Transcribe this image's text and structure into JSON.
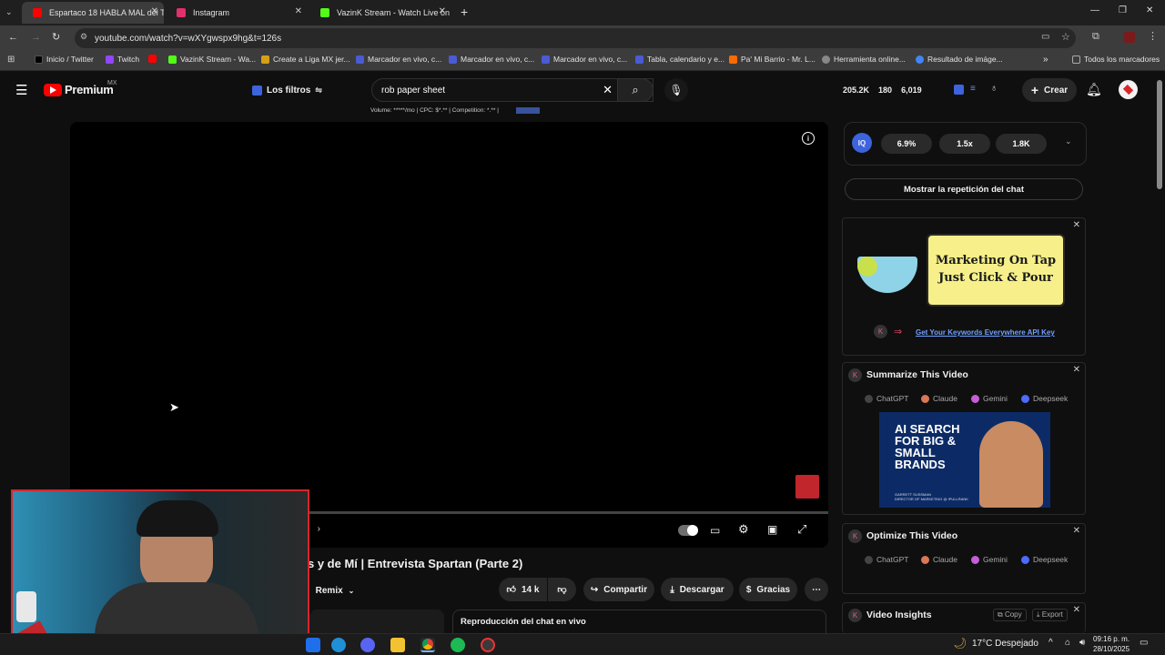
{
  "browser": {
    "tabs": [
      {
        "label": "Espartaco 18 HABLA MAL del T",
        "color": "#ff0000"
      },
      {
        "label": "Instagram",
        "color": "#e1306c"
      },
      {
        "label": "VazinK Stream - Watch Live on",
        "color": "#53fc18"
      }
    ],
    "new_tab": "+",
    "url": "youtube.com/watch?v=wXYgwspx9hg&t=126s",
    "bookmarks": [
      {
        "label": "Inicio / Twitter",
        "color": "#000000"
      },
      {
        "label": "Twitch",
        "color": "#9146ff"
      },
      {
        "label": "",
        "color": "#ff0000"
      },
      {
        "label": "VazinK Stream - Wa...",
        "color": "#53fc18"
      },
      {
        "label": "Create a Liga MX jer...",
        "color": "#d4a017"
      },
      {
        "label": "Marcador en vivo, c...",
        "color": "#4a5bd4"
      },
      {
        "label": "Marcador en vivo, c...",
        "color": "#4a5bd4"
      },
      {
        "label": "Marcador en vivo, c...",
        "color": "#4a5bd4"
      },
      {
        "label": "Tabla, calendario y e...",
        "color": "#4a5bd4"
      },
      {
        "label": "Pa' Mi Barrio - Mr. L...",
        "color": "#ff6a00"
      },
      {
        "label": "Herramienta online...",
        "color": "#888888"
      },
      {
        "label": "Resultado de imáge...",
        "color": "#4285f4"
      }
    ],
    "bookmarks_more": "»",
    "all_bookmarks": "Todos los marcadores"
  },
  "youtube": {
    "logo": "Premium",
    "region": "MX",
    "filters_label": "Los filtros",
    "search_value": "rob paper sheet",
    "keyword_stats": "Volume: *****/mo | CPC: $*.** | Competition: *.** |",
    "header_stats": {
      "a": "205.2K",
      "b": "180",
      "c": "6,019"
    },
    "create_label": "Crear",
    "video_title": "s y de Mí | Entrevista Spartan (Parte 2)",
    "remix_label": "Remix",
    "likes": "14 k",
    "share_label": "Compartir",
    "download_label": "Descargar",
    "thanks_label": "Gracias",
    "chat_replay_bottom": "Reproducción del chat en vivo",
    "ctrl_more": "o"
  },
  "sidebar": {
    "metrics": [
      "6.9%",
      "1.5x",
      "1.8K"
    ],
    "show_chat_replay": "Mostrar la repetición del chat",
    "ad": {
      "headline1": "Marketing On Tap",
      "headline2": "Just Click & Pour",
      "link": "Get Your Keywords Everywhere API Key"
    },
    "summarize": {
      "title": "Summarize This Video",
      "tools": [
        "ChatGPT",
        "Claude",
        "Gemini",
        "Deepseek"
      ],
      "banner_line1": "AI SEARCH",
      "banner_line2": "FOR BIG &",
      "banner_line3": "SMALL",
      "banner_line4": "BRANDS",
      "banner_caption1": "GARRETT SUSSMAN",
      "banner_caption2": "DIRECTOR OF MARKETING @ IPULLRANK"
    },
    "optimize": {
      "title": "Optimize This Video",
      "tools": [
        "ChatGPT",
        "Claude",
        "Gemini",
        "Deepseek"
      ]
    },
    "insights": {
      "title": "Video Insights",
      "copy": "Copy",
      "export": "Export"
    }
  },
  "taskbar": {
    "weather": "17°C  Despejado",
    "time": "09:16 p. m.",
    "date": "28/10/2025"
  }
}
